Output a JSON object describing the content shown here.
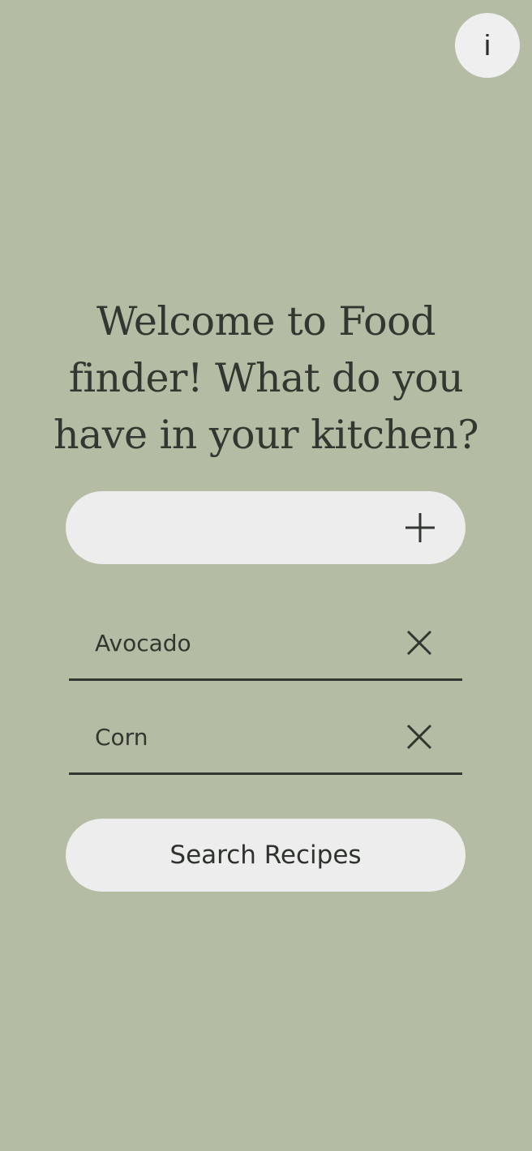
{
  "info_button": {
    "label": "i",
    "icon": "info-icon"
  },
  "heading": {
    "text": "Welcome to Food finder! What do you have in your kitchen?"
  },
  "add_ingredient": {
    "value": "",
    "placeholder": "",
    "icon": "plus-icon"
  },
  "ingredients": [
    {
      "label": "Avocado",
      "remove_icon": "close-icon"
    },
    {
      "label": "Corn",
      "remove_icon": "close-icon"
    }
  ],
  "search_button": {
    "label": "Search Recipes"
  },
  "colors": {
    "background": "#b4bca4",
    "surface": "#ededed",
    "text": "#333731"
  }
}
